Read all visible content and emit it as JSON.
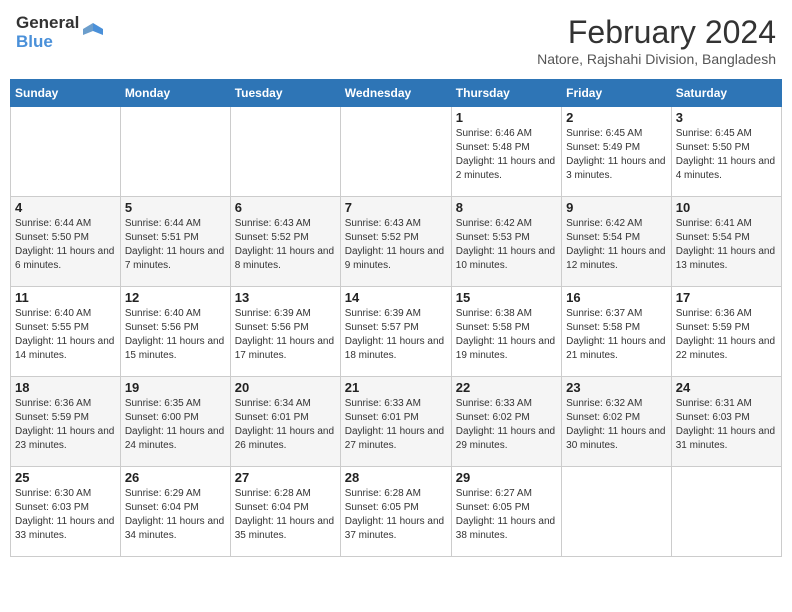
{
  "logo": {
    "line1": "General",
    "line2": "Blue"
  },
  "title": "February 2024",
  "subtitle": "Natore, Rajshahi Division, Bangladesh",
  "days_of_week": [
    "Sunday",
    "Monday",
    "Tuesday",
    "Wednesday",
    "Thursday",
    "Friday",
    "Saturday"
  ],
  "weeks": [
    [
      {
        "day": "",
        "info": ""
      },
      {
        "day": "",
        "info": ""
      },
      {
        "day": "",
        "info": ""
      },
      {
        "day": "",
        "info": ""
      },
      {
        "day": "1",
        "info": "Sunrise: 6:46 AM\nSunset: 5:48 PM\nDaylight: 11 hours and 2 minutes."
      },
      {
        "day": "2",
        "info": "Sunrise: 6:45 AM\nSunset: 5:49 PM\nDaylight: 11 hours and 3 minutes."
      },
      {
        "day": "3",
        "info": "Sunrise: 6:45 AM\nSunset: 5:50 PM\nDaylight: 11 hours and 4 minutes."
      }
    ],
    [
      {
        "day": "4",
        "info": "Sunrise: 6:44 AM\nSunset: 5:50 PM\nDaylight: 11 hours and 6 minutes."
      },
      {
        "day": "5",
        "info": "Sunrise: 6:44 AM\nSunset: 5:51 PM\nDaylight: 11 hours and 7 minutes."
      },
      {
        "day": "6",
        "info": "Sunrise: 6:43 AM\nSunset: 5:52 PM\nDaylight: 11 hours and 8 minutes."
      },
      {
        "day": "7",
        "info": "Sunrise: 6:43 AM\nSunset: 5:52 PM\nDaylight: 11 hours and 9 minutes."
      },
      {
        "day": "8",
        "info": "Sunrise: 6:42 AM\nSunset: 5:53 PM\nDaylight: 11 hours and 10 minutes."
      },
      {
        "day": "9",
        "info": "Sunrise: 6:42 AM\nSunset: 5:54 PM\nDaylight: 11 hours and 12 minutes."
      },
      {
        "day": "10",
        "info": "Sunrise: 6:41 AM\nSunset: 5:54 PM\nDaylight: 11 hours and 13 minutes."
      }
    ],
    [
      {
        "day": "11",
        "info": "Sunrise: 6:40 AM\nSunset: 5:55 PM\nDaylight: 11 hours and 14 minutes."
      },
      {
        "day": "12",
        "info": "Sunrise: 6:40 AM\nSunset: 5:56 PM\nDaylight: 11 hours and 15 minutes."
      },
      {
        "day": "13",
        "info": "Sunrise: 6:39 AM\nSunset: 5:56 PM\nDaylight: 11 hours and 17 minutes."
      },
      {
        "day": "14",
        "info": "Sunrise: 6:39 AM\nSunset: 5:57 PM\nDaylight: 11 hours and 18 minutes."
      },
      {
        "day": "15",
        "info": "Sunrise: 6:38 AM\nSunset: 5:58 PM\nDaylight: 11 hours and 19 minutes."
      },
      {
        "day": "16",
        "info": "Sunrise: 6:37 AM\nSunset: 5:58 PM\nDaylight: 11 hours and 21 minutes."
      },
      {
        "day": "17",
        "info": "Sunrise: 6:36 AM\nSunset: 5:59 PM\nDaylight: 11 hours and 22 minutes."
      }
    ],
    [
      {
        "day": "18",
        "info": "Sunrise: 6:36 AM\nSunset: 5:59 PM\nDaylight: 11 hours and 23 minutes."
      },
      {
        "day": "19",
        "info": "Sunrise: 6:35 AM\nSunset: 6:00 PM\nDaylight: 11 hours and 24 minutes."
      },
      {
        "day": "20",
        "info": "Sunrise: 6:34 AM\nSunset: 6:01 PM\nDaylight: 11 hours and 26 minutes."
      },
      {
        "day": "21",
        "info": "Sunrise: 6:33 AM\nSunset: 6:01 PM\nDaylight: 11 hours and 27 minutes."
      },
      {
        "day": "22",
        "info": "Sunrise: 6:33 AM\nSunset: 6:02 PM\nDaylight: 11 hours and 29 minutes."
      },
      {
        "day": "23",
        "info": "Sunrise: 6:32 AM\nSunset: 6:02 PM\nDaylight: 11 hours and 30 minutes."
      },
      {
        "day": "24",
        "info": "Sunrise: 6:31 AM\nSunset: 6:03 PM\nDaylight: 11 hours and 31 minutes."
      }
    ],
    [
      {
        "day": "25",
        "info": "Sunrise: 6:30 AM\nSunset: 6:03 PM\nDaylight: 11 hours and 33 minutes."
      },
      {
        "day": "26",
        "info": "Sunrise: 6:29 AM\nSunset: 6:04 PM\nDaylight: 11 hours and 34 minutes."
      },
      {
        "day": "27",
        "info": "Sunrise: 6:28 AM\nSunset: 6:04 PM\nDaylight: 11 hours and 35 minutes."
      },
      {
        "day": "28",
        "info": "Sunrise: 6:28 AM\nSunset: 6:05 PM\nDaylight: 11 hours and 37 minutes."
      },
      {
        "day": "29",
        "info": "Sunrise: 6:27 AM\nSunset: 6:05 PM\nDaylight: 11 hours and 38 minutes."
      },
      {
        "day": "",
        "info": ""
      },
      {
        "day": "",
        "info": ""
      }
    ]
  ]
}
